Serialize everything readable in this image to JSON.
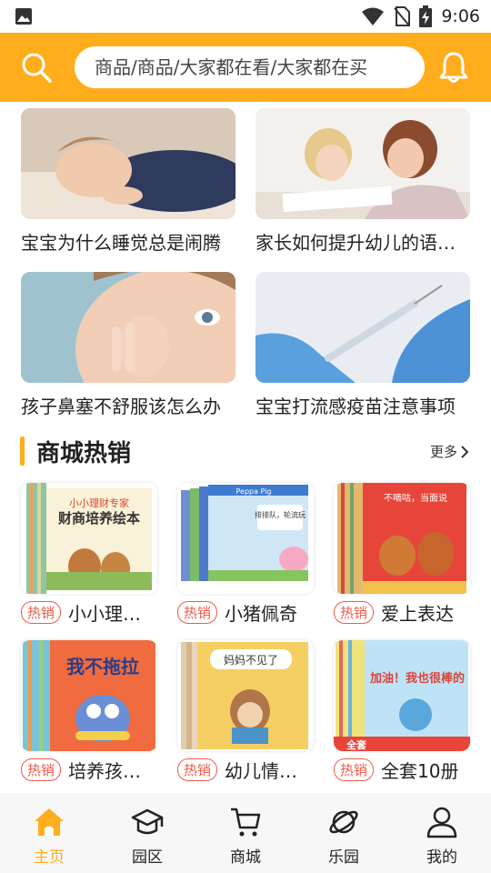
{
  "status_bar": {
    "time": "9:06"
  },
  "header": {
    "search_placeholder": "商品/商品/大家都在看/大家都在买",
    "accent_color": "#ffad1d"
  },
  "articles": [
    {
      "title": "宝宝为什么睡觉总是闹腾"
    },
    {
      "title": "家长如何提升幼儿的语言能力"
    },
    {
      "title": "孩子鼻塞不舒服该怎么办"
    },
    {
      "title": "宝宝打流感疫苗注意事项"
    }
  ],
  "section": {
    "title": "商城热销",
    "more_label": "更多"
  },
  "products": [
    {
      "badge": "热销",
      "name": "小小理财专家",
      "cover_title": "财商培养绘本",
      "cover_top": "小小理财专家"
    },
    {
      "badge": "热销",
      "name": "小猪佩奇",
      "cover_title": "排排队，轮流玩",
      "cover_top": "Peppa Pig"
    },
    {
      "badge": "热销",
      "name": "爱上表达",
      "cover_title": "不嘀咕，当面说",
      "cover_top": ""
    },
    {
      "badge": "热销",
      "name": "培养孩子好习惯",
      "cover_title": "我不拖拉",
      "cover_top": ""
    },
    {
      "badge": "热销",
      "name": "幼儿情绪管理",
      "cover_title": "妈妈不见了",
      "cover_top": ""
    },
    {
      "badge": "热销",
      "name": "全套10册",
      "cover_title": "加油！我也很棒的",
      "cover_top": "全套"
    }
  ],
  "tabs": [
    {
      "label": "主页",
      "icon": "home-icon",
      "active": true
    },
    {
      "label": "园区",
      "icon": "graduation-cap-icon",
      "active": false
    },
    {
      "label": "商城",
      "icon": "cart-icon",
      "active": false
    },
    {
      "label": "乐园",
      "icon": "planet-icon",
      "active": false
    },
    {
      "label": "我的",
      "icon": "user-icon",
      "active": false
    }
  ]
}
